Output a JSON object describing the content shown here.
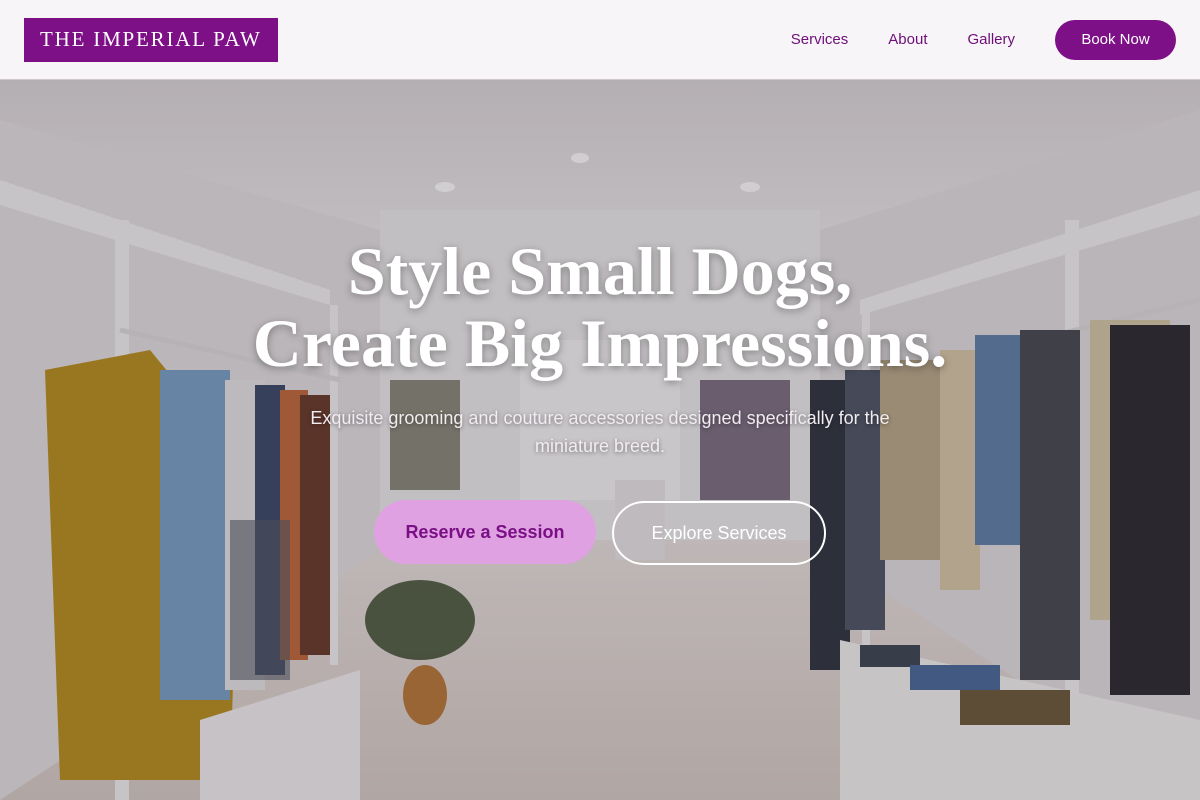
{
  "brand": {
    "name": "THE IMPERIAL PAW"
  },
  "nav": {
    "links": [
      {
        "label": "Services"
      },
      {
        "label": "About"
      },
      {
        "label": "Gallery"
      }
    ],
    "book_label": "Book Now"
  },
  "hero": {
    "title_line1": "Style Small Dogs,",
    "title_line2": "Create Big Impressions.",
    "subtitle": "Exquisite grooming and couture accessories designed specifically for the miniature breed.",
    "primary_cta": "Reserve a Session",
    "secondary_cta": "Explore Services"
  },
  "colors": {
    "brand_purple": "#7d0f87",
    "cta_light": "#dfa1e2",
    "nav_text": "#6e0f79"
  }
}
